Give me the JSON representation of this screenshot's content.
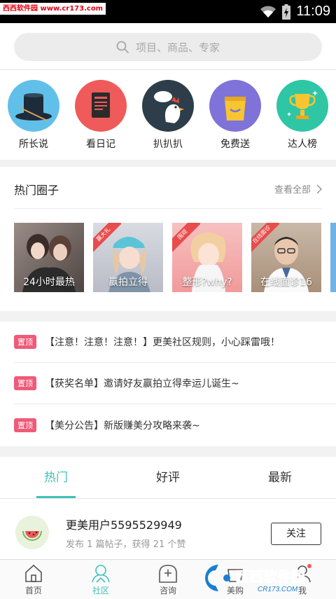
{
  "status_bar": {
    "watermark": "西西软件园 www.cr173.com",
    "time": "11:09"
  },
  "search": {
    "placeholder": "项目、商品、专家",
    "icon": "search-icon"
  },
  "categories": [
    {
      "label": "所长说",
      "icon": "top-hat-icon",
      "color": "#61c0ea"
    },
    {
      "label": "看日记",
      "icon": "diary-icon",
      "color": "#ef5a5a"
    },
    {
      "label": "扒扒扒",
      "icon": "chicken-icon",
      "color": "#2d3e4a"
    },
    {
      "label": "免费送",
      "icon": "shopping-bag-icon",
      "color": "#7f72d8"
    },
    {
      "label": "达人榜",
      "icon": "trophy-icon",
      "color": "#2ec6a5"
    }
  ],
  "hot_circles": {
    "title": "热门圈子",
    "more": "查看全部",
    "items": [
      {
        "label": "24小时最热",
        "ribbon": ""
      },
      {
        "label": "赢拍立得",
        "ribbon": "赢大礼"
      },
      {
        "label": "整形?why?",
        "ribbon": "围观"
      },
      {
        "label": "在线面诊16",
        "ribbon": "在线面诊"
      }
    ]
  },
  "notices": {
    "pin_label": "置顶",
    "items": [
      "【注意！注意！注意！】更美社区规则，小心踩雷哦！",
      "【获奖名单】邀请好友赢拍立得幸运儿诞生~",
      "【美分公告】新版赚美分攻略来袭~"
    ]
  },
  "tabs": [
    "热门",
    "好评",
    "最新"
  ],
  "user_card": {
    "name": "更美用户5595529949",
    "meta": "发布 1 篇帖子，获得 21 个赞",
    "follow": "关注"
  },
  "bottom_nav": [
    "首页",
    "社区",
    "咨询",
    "美购",
    "我"
  ],
  "brand_overlay": {
    "text": "西西软件园",
    "url": "CR173.COM"
  },
  "colors": {
    "accent": "#3fc2b8",
    "pin": "#ef5a79"
  }
}
